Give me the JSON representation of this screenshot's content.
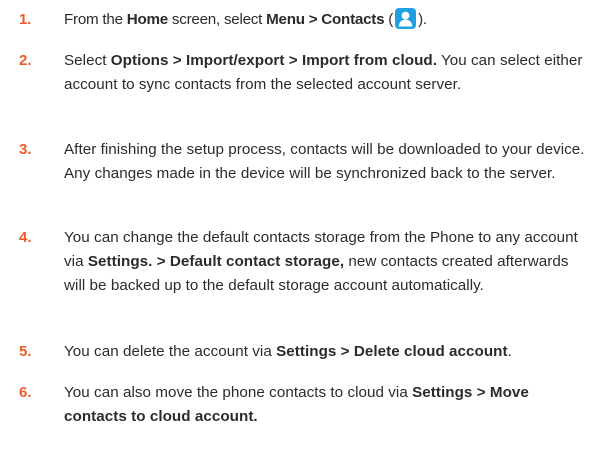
{
  "colors": {
    "step_number": "#f05a28",
    "body_text": "#2b2b2b",
    "contacts_icon_bg": "#1fa0e0",
    "contacts_icon_fg": "#ffffff"
  },
  "icons": {
    "contacts": "contacts-person-icon"
  },
  "steps": [
    {
      "number": "1.",
      "segments": [
        {
          "text": "From the ",
          "bold": false
        },
        {
          "text": "Home",
          "bold": true
        },
        {
          "text": " screen, select ",
          "bold": false
        },
        {
          "text": "Menu > Contacts",
          "bold": true
        },
        {
          "text": " (",
          "bold": false
        },
        {
          "icon": "contacts"
        },
        {
          "text": ").",
          "bold": false
        }
      ]
    },
    {
      "number": "2.",
      "segments": [
        {
          "text": "Select ",
          "bold": false
        },
        {
          "text": "Options > Import/export > Import from cloud.",
          "bold": true
        },
        {
          "text": " You can select either account to sync contacts from the selected account server.",
          "bold": false
        }
      ]
    },
    {
      "number": "3.",
      "segments": [
        {
          "text": "After finishing the setup process, contacts will be downloaded to your device. Any changes made in the device will be synchronized back to the server.",
          "bold": false
        }
      ]
    },
    {
      "number": "4.",
      "segments": [
        {
          "text": "You can change the default contacts storage from the Phone to any account via ",
          "bold": false
        },
        {
          "text": "Settings. > Default contact storage,",
          "bold": true
        },
        {
          "text": " new contacts created afterwards will be backed up to the default storage account automatically.",
          "bold": false
        }
      ]
    },
    {
      "number": "5.",
      "segments": [
        {
          "text": "You can delete the account via ",
          "bold": false
        },
        {
          "text": "Settings > Delete cloud account",
          "bold": true
        },
        {
          "text": ".",
          "bold": false
        }
      ]
    },
    {
      "number": "6.",
      "segments": [
        {
          "text": "You can also move the phone contacts to cloud via ",
          "bold": false
        },
        {
          "text": "Settings > Move contacts to cloud account.",
          "bold": true
        }
      ]
    }
  ]
}
